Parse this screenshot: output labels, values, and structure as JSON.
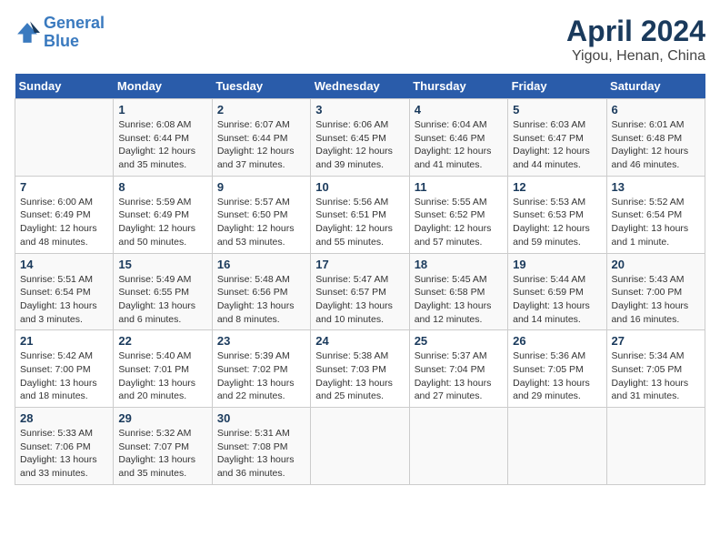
{
  "header": {
    "logo_line1": "General",
    "logo_line2": "Blue",
    "title": "April 2024",
    "subtitle": "Yigou, Henan, China"
  },
  "calendar": {
    "days_of_week": [
      "Sunday",
      "Monday",
      "Tuesday",
      "Wednesday",
      "Thursday",
      "Friday",
      "Saturday"
    ],
    "weeks": [
      [
        {
          "day": "",
          "info": ""
        },
        {
          "day": "1",
          "info": "Sunrise: 6:08 AM\nSunset: 6:44 PM\nDaylight: 12 hours\nand 35 minutes."
        },
        {
          "day": "2",
          "info": "Sunrise: 6:07 AM\nSunset: 6:44 PM\nDaylight: 12 hours\nand 37 minutes."
        },
        {
          "day": "3",
          "info": "Sunrise: 6:06 AM\nSunset: 6:45 PM\nDaylight: 12 hours\nand 39 minutes."
        },
        {
          "day": "4",
          "info": "Sunrise: 6:04 AM\nSunset: 6:46 PM\nDaylight: 12 hours\nand 41 minutes."
        },
        {
          "day": "5",
          "info": "Sunrise: 6:03 AM\nSunset: 6:47 PM\nDaylight: 12 hours\nand 44 minutes."
        },
        {
          "day": "6",
          "info": "Sunrise: 6:01 AM\nSunset: 6:48 PM\nDaylight: 12 hours\nand 46 minutes."
        }
      ],
      [
        {
          "day": "7",
          "info": "Sunrise: 6:00 AM\nSunset: 6:49 PM\nDaylight: 12 hours\nand 48 minutes."
        },
        {
          "day": "8",
          "info": "Sunrise: 5:59 AM\nSunset: 6:49 PM\nDaylight: 12 hours\nand 50 minutes."
        },
        {
          "day": "9",
          "info": "Sunrise: 5:57 AM\nSunset: 6:50 PM\nDaylight: 12 hours\nand 53 minutes."
        },
        {
          "day": "10",
          "info": "Sunrise: 5:56 AM\nSunset: 6:51 PM\nDaylight: 12 hours\nand 55 minutes."
        },
        {
          "day": "11",
          "info": "Sunrise: 5:55 AM\nSunset: 6:52 PM\nDaylight: 12 hours\nand 57 minutes."
        },
        {
          "day": "12",
          "info": "Sunrise: 5:53 AM\nSunset: 6:53 PM\nDaylight: 12 hours\nand 59 minutes."
        },
        {
          "day": "13",
          "info": "Sunrise: 5:52 AM\nSunset: 6:54 PM\nDaylight: 13 hours\nand 1 minute."
        }
      ],
      [
        {
          "day": "14",
          "info": "Sunrise: 5:51 AM\nSunset: 6:54 PM\nDaylight: 13 hours\nand 3 minutes."
        },
        {
          "day": "15",
          "info": "Sunrise: 5:49 AM\nSunset: 6:55 PM\nDaylight: 13 hours\nand 6 minutes."
        },
        {
          "day": "16",
          "info": "Sunrise: 5:48 AM\nSunset: 6:56 PM\nDaylight: 13 hours\nand 8 minutes."
        },
        {
          "day": "17",
          "info": "Sunrise: 5:47 AM\nSunset: 6:57 PM\nDaylight: 13 hours\nand 10 minutes."
        },
        {
          "day": "18",
          "info": "Sunrise: 5:45 AM\nSunset: 6:58 PM\nDaylight: 13 hours\nand 12 minutes."
        },
        {
          "day": "19",
          "info": "Sunrise: 5:44 AM\nSunset: 6:59 PM\nDaylight: 13 hours\nand 14 minutes."
        },
        {
          "day": "20",
          "info": "Sunrise: 5:43 AM\nSunset: 7:00 PM\nDaylight: 13 hours\nand 16 minutes."
        }
      ],
      [
        {
          "day": "21",
          "info": "Sunrise: 5:42 AM\nSunset: 7:00 PM\nDaylight: 13 hours\nand 18 minutes."
        },
        {
          "day": "22",
          "info": "Sunrise: 5:40 AM\nSunset: 7:01 PM\nDaylight: 13 hours\nand 20 minutes."
        },
        {
          "day": "23",
          "info": "Sunrise: 5:39 AM\nSunset: 7:02 PM\nDaylight: 13 hours\nand 22 minutes."
        },
        {
          "day": "24",
          "info": "Sunrise: 5:38 AM\nSunset: 7:03 PM\nDaylight: 13 hours\nand 25 minutes."
        },
        {
          "day": "25",
          "info": "Sunrise: 5:37 AM\nSunset: 7:04 PM\nDaylight: 13 hours\nand 27 minutes."
        },
        {
          "day": "26",
          "info": "Sunrise: 5:36 AM\nSunset: 7:05 PM\nDaylight: 13 hours\nand 29 minutes."
        },
        {
          "day": "27",
          "info": "Sunrise: 5:34 AM\nSunset: 7:05 PM\nDaylight: 13 hours\nand 31 minutes."
        }
      ],
      [
        {
          "day": "28",
          "info": "Sunrise: 5:33 AM\nSunset: 7:06 PM\nDaylight: 13 hours\nand 33 minutes."
        },
        {
          "day": "29",
          "info": "Sunrise: 5:32 AM\nSunset: 7:07 PM\nDaylight: 13 hours\nand 35 minutes."
        },
        {
          "day": "30",
          "info": "Sunrise: 5:31 AM\nSunset: 7:08 PM\nDaylight: 13 hours\nand 36 minutes."
        },
        {
          "day": "",
          "info": ""
        },
        {
          "day": "",
          "info": ""
        },
        {
          "day": "",
          "info": ""
        },
        {
          "day": "",
          "info": ""
        }
      ]
    ]
  }
}
